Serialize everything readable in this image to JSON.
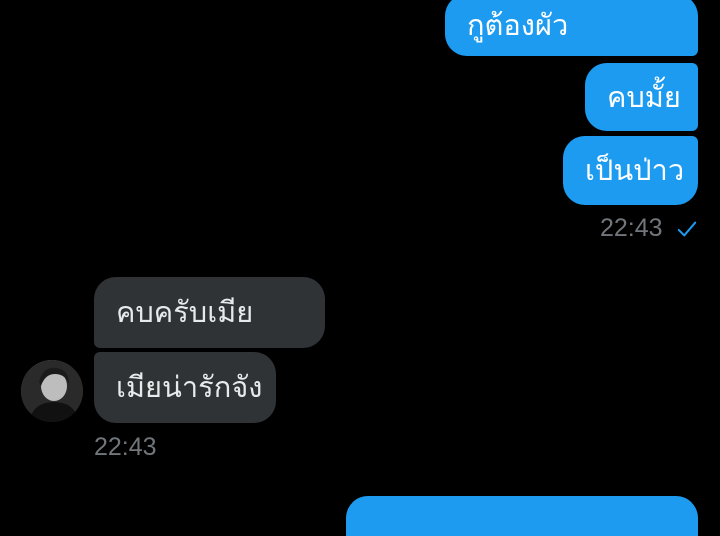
{
  "messages": {
    "outgoing": [
      "กูต้องผัว",
      "คบมั้ย",
      "เป็นป่าว"
    ],
    "outgoing_time": "22:43",
    "incoming": [
      "คบครับเมีย",
      "เมียน่ารักจัง"
    ],
    "incoming_time": "22:43"
  },
  "colors": {
    "outgoing_bubble": "#1d9bf0",
    "incoming_bubble": "#2f3336",
    "timestamp": "#71767b",
    "read_check": "#1d9bf0"
  },
  "icons": {
    "read_receipt": "check-icon",
    "avatar": "avatar"
  }
}
